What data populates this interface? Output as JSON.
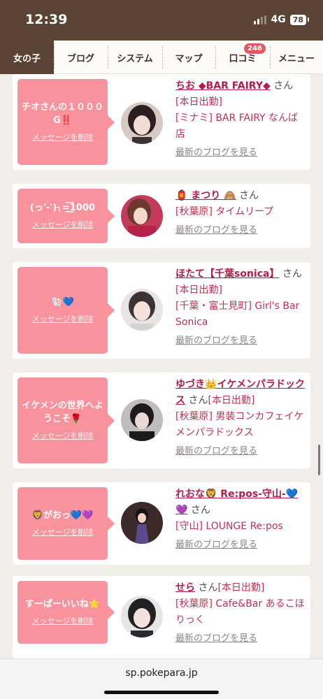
{
  "status": {
    "time": "12:39",
    "network": "4G",
    "battery": "78"
  },
  "nav": {
    "tabs": [
      {
        "label": "女の子",
        "active": true
      },
      {
        "label": "ブログ"
      },
      {
        "label": "システム"
      },
      {
        "label": "マップ"
      },
      {
        "label": "口コミ",
        "badge": "246"
      },
      {
        "label": "メニュー"
      }
    ]
  },
  "cards": [
    {
      "message": "チオさんの１０００G‼️",
      "delete": "メッセージを削除",
      "name": "ちお ◆BAR FAIRY◆",
      "san": "さん",
      "status": "[本日出勤]",
      "area": "[ミナミ]",
      "shop": "BAR FAIRY なんば店",
      "blog": "最新のブログを見る"
    },
    {
      "message": "(っ'-')╮=͟͟͞͞1000",
      "delete": "メッセージを削除",
      "name": "🏮 まつり 🙈",
      "san": "さん",
      "status": "",
      "area": "[秋葉原]",
      "shop": "タイムリープ",
      "blog": "最新のブログを見る"
    },
    {
      "message": "🐚💙",
      "delete": "メッセージを削除",
      "name": "ほたて【千葉sonica】",
      "san": "さん",
      "status": "[本日出勤]",
      "area": "[千葉・富士見町]",
      "shop": "Girl's Bar Sonica",
      "blog": "最新のブログを見る"
    },
    {
      "message": "イケメンの世界へようこそ🌹",
      "delete": "メッセージを削除",
      "name": "ゆづき👑イケメンパラドックス",
      "san": "さん",
      "status": "[本日出勤]",
      "area": "[秋葉原]",
      "shop": "男装コンカフェイケメンパラドックス",
      "blog": "最新のブログを見る"
    },
    {
      "message": "🦁がおっ💙💜",
      "delete": "メッセージを削除",
      "name": "れおな🦁 Re:pos-守山-💙💜",
      "san": "さん",
      "status": "",
      "area": "[守山]",
      "shop": "LOUNGE Re:pos",
      "blog": "最新のブログを見る"
    },
    {
      "message": "すーぱーいいね⭐",
      "delete": "メッセージを削除",
      "name": "せら",
      "san": "さん",
      "status": "[本日出勤]",
      "area": "[秋葉原]",
      "shop": "Cafe&Bar あるこほりっく",
      "blog": "最新のブログを見る"
    }
  ],
  "browser": {
    "url": "sp.pokepara.jp"
  },
  "colors": {
    "header": "#5a4234",
    "bubble": "#f8929c",
    "name": "#b31d48",
    "badge": "#e05a62"
  }
}
